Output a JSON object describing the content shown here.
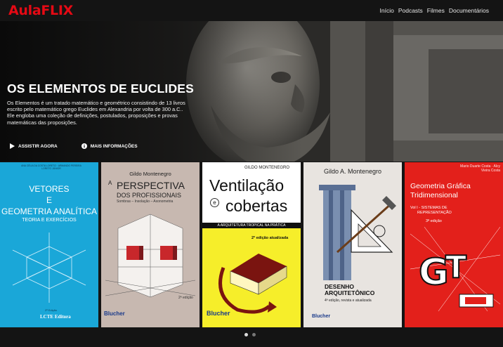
{
  "brand": {
    "name": "AulaFLIX"
  },
  "nav": {
    "items": [
      "Início",
      "Podcasts",
      "Filmes",
      "Documentários"
    ]
  },
  "hero": {
    "title": "OS ELEMENTOS DE EUCLIDES",
    "description": "Os Elementos é um tratado matemático e geométrico consistindo de 13 livros escrito pelo matemático grego Euclides em Alexandria por volta de 300 a.C.. Ele engloba uma coleção de definições, postulados, proposições e provas matemáticas das proposições.",
    "play_label": "ASSISTIR AGORA",
    "info_label": "MAIS INFORMAÇÕES"
  },
  "books": [
    {
      "authors": "ANA CÉLIA DA COSTA LORETO · ARMANDO PEREIRA LORETO JÚNIOR",
      "title_line1": "VETORES",
      "title_line2": "E",
      "title_line3": "GEOMETRIA ANALÍTICA",
      "subtitle": "TEORIA E EXERCÍCIOS",
      "edition": "2ª Edição",
      "publisher": "LCTE Editora"
    },
    {
      "author": "Gildo Montenegro",
      "title_a": "A",
      "title_line1": "PERSPECTIVA",
      "title_line2": "DOS PROFISSIONAIS",
      "subtitle": "Sombras – Insolação – Axonometria",
      "edition": "2ª edição",
      "publisher": "Blucher"
    },
    {
      "author": "GILDO MONTENEGRO",
      "title_line1": "Ventilação",
      "title_e": "e",
      "title_line2": "cobertas",
      "subtitle": "A ARQUITETURA TROPICAL NA PRÁTICA",
      "edition": "2ª edição atualizada",
      "publisher": "Blucher"
    },
    {
      "author": "Gildo A. Montenegro",
      "title_line1": "DESENHO",
      "title_line2": "ARQUITETÔNICO",
      "edition": "4ª edição, revista e atualizada",
      "publisher": "Blucher"
    },
    {
      "authors": "Mario Duarte Costa · Alcy Vieira Costa",
      "title_line1": "Geometria Gráfica",
      "title_line2": "Tridimensional",
      "volume_line1": "Vol I - SISTEMAS DE",
      "volume_line2": "REPRESENTAÇÃO",
      "edition": "3ª edição",
      "logo_letters": "GGT"
    }
  ],
  "carousel": {
    "pages": 2,
    "active": 1
  },
  "colors": {
    "brand": "#e50914",
    "background": "#141414"
  }
}
